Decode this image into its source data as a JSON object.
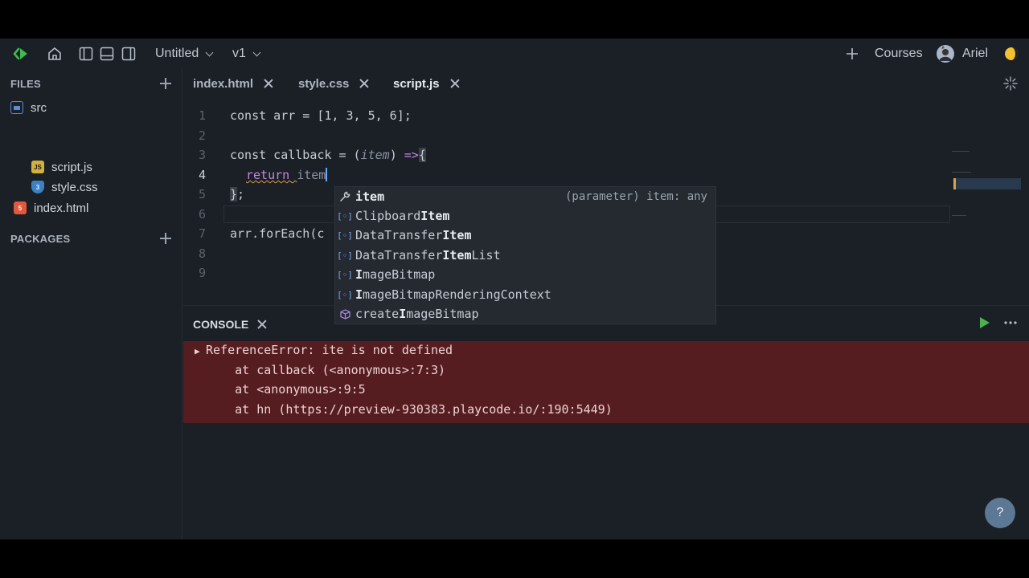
{
  "topbar": {
    "project_name": "Untitled",
    "version": "v1",
    "courses_label": "Courses",
    "user_name": "Ariel"
  },
  "sidebar": {
    "files_header": "FILES",
    "packages_header": "PACKAGES",
    "tree": [
      {
        "label": "src",
        "icon": "folder-icon"
      },
      {
        "label": "script.js",
        "icon": "js-file-icon"
      },
      {
        "label": "style.css",
        "icon": "css-file-icon"
      },
      {
        "label": "index.html",
        "icon": "html-file-icon"
      }
    ]
  },
  "tabs": [
    {
      "label": "index.html"
    },
    {
      "label": "style.css"
    },
    {
      "label": "script.js",
      "active": true
    }
  ],
  "editor": {
    "line_numbers": [
      "1",
      "2",
      "3",
      "4",
      "5",
      "6",
      "7",
      "8",
      "9"
    ],
    "current_line": 4,
    "lines": {
      "l1": "const arr = [1, 3, 5, 6];",
      "l3_a": "const callback = (",
      "l3_param": "item",
      "l3_b": ") ",
      "l3_arrow": "=>",
      "l3_brace": "{",
      "l4_kw": "return ",
      "l4_typed": "item",
      "l5_brace": "}",
      "l5_semi": ";",
      "l7": "arr.forEach(c"
    }
  },
  "autocomplete": {
    "items": [
      {
        "pre": "",
        "bold": "item",
        "post": "",
        "icon": "wrench-icon",
        "detail": "(parameter) item: any"
      },
      {
        "pre": "Clipboard",
        "bold": "Item",
        "post": "",
        "icon": "variable-icon"
      },
      {
        "pre": "DataTransfer",
        "bold": "Item",
        "post": "",
        "icon": "variable-icon"
      },
      {
        "pre": "DataTransfer",
        "bold": "Item",
        "post": "List",
        "icon": "variable-icon"
      },
      {
        "pre": "",
        "bold": "I",
        "post": "mageBitmap",
        "icon": "variable-icon"
      },
      {
        "pre": "",
        "bold": "I",
        "post": "mageBitmapRenderingContext",
        "icon": "variable-icon"
      },
      {
        "pre": "create",
        "bold": "I",
        "post": "mageBitmap",
        "icon": "cube-icon"
      }
    ]
  },
  "console": {
    "title": "CONSOLE",
    "error_lines": [
      "ReferenceError: ite is not defined",
      "    at callback (<anonymous>:7:3)",
      "    at <anonymous>:9:5",
      "    at hn (https://preview-930383.playcode.io/:190:5449)"
    ]
  },
  "help_label": "?",
  "colors": {
    "background": "#1b1f26",
    "error_bg": "#561d20",
    "accent_green": "#4caf50",
    "cursor_blue": "#6aa8ff",
    "keyword_purple": "#c587e0"
  }
}
